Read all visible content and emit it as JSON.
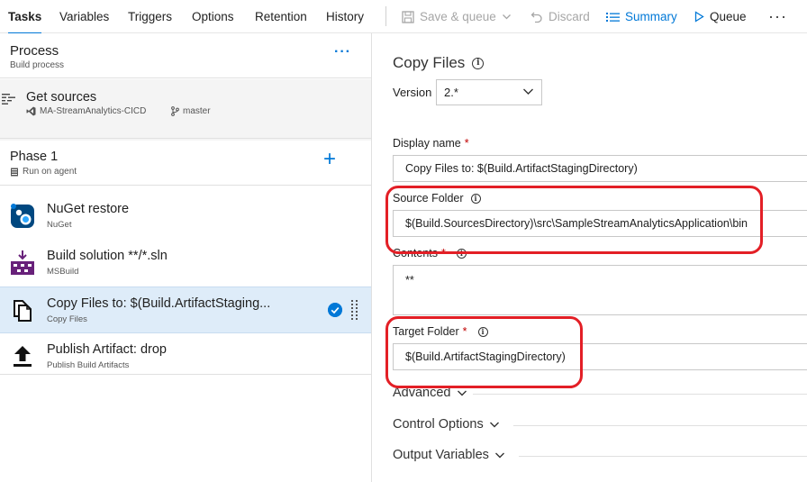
{
  "tabs": [
    {
      "label": "Tasks",
      "active": true
    },
    {
      "label": "Variables"
    },
    {
      "label": "Triggers"
    },
    {
      "label": "Options"
    },
    {
      "label": "Retention"
    },
    {
      "label": "History"
    }
  ],
  "toolbar": {
    "save_label": "Save & queue",
    "discard_label": "Discard",
    "summary_label": "Summary",
    "queue_label": "Queue",
    "more_label": "···"
  },
  "process": {
    "title": "Process",
    "subtitle": "Build process",
    "more_label": "···"
  },
  "sources": {
    "title": "Get sources",
    "repo": "MA-StreamAnalytics-CICD",
    "branch": "master"
  },
  "phase": {
    "title": "Phase 1",
    "subtitle": "Run on agent",
    "add_label": "+"
  },
  "tasks": [
    {
      "name": "NuGet restore",
      "type": "NuGet"
    },
    {
      "name": "Build solution **/*.sln",
      "type": "MSBuild"
    },
    {
      "name": "Copy Files to: $(Build.ArtifactStaging...",
      "type": "Copy Files",
      "selected": true
    },
    {
      "name": "Publish Artifact: drop",
      "type": "Publish Build Artifacts"
    }
  ],
  "details": {
    "title": "Copy Files",
    "info_glyph": "i",
    "version_label": "Version",
    "version_value": "2.*",
    "display_name_label": "Display name",
    "display_name_value": "Copy Files to: $(Build.ArtifactStagingDirectory)",
    "source_folder_label": "Source Folder",
    "source_folder_value": "$(Build.SourcesDirectory)\\src\\SampleStreamAnalyticsApplication\\bin",
    "contents_label": "Contents",
    "contents_value": "**",
    "target_folder_label": "Target Folder",
    "target_folder_value": "$(Build.ArtifactStagingDirectory)",
    "required_mark": "*",
    "advanced_label": "Advanced",
    "control_options_label": "Control Options",
    "output_variables_label": "Output Variables"
  },
  "colors": {
    "accent": "#0078d7",
    "selected_row": "#deecf9",
    "annotation": "#e31f26",
    "required": "#c00000"
  }
}
